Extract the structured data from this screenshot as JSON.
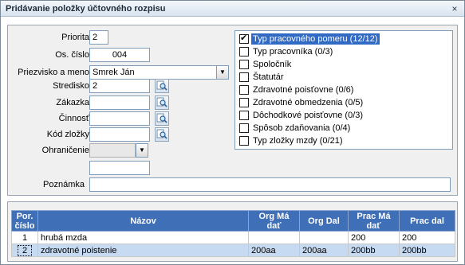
{
  "window": {
    "title": "Pridávanie položky účtovného rozpisu",
    "close_glyph": "×"
  },
  "form": {
    "priorita": {
      "label": "Priorita",
      "value": "2"
    },
    "os_cislo": {
      "label": "Os. číslo",
      "value": "004"
    },
    "priezvisko": {
      "label": "Priezvisko a meno",
      "value": "Smrek Ján"
    },
    "stredisko": {
      "label": "Stredisko",
      "value": "2"
    },
    "zakazka": {
      "label": "Zákazka",
      "value": ""
    },
    "cinnost": {
      "label": "Činnosť",
      "value": ""
    },
    "kod_zlozky": {
      "label": "Kód zložky",
      "value": ""
    },
    "obmedzenie": {
      "label": "Ohraničenie",
      "value": ""
    },
    "extra": {
      "value": ""
    },
    "poznamka": {
      "label": "Poznámka",
      "value": ""
    }
  },
  "icons": {
    "lookup": "search-lookup-icon",
    "dropdown": "chevron-down-icon"
  },
  "checklist": [
    {
      "label": "Typ pracovného pomeru (12/12)",
      "checked": true,
      "selected": true
    },
    {
      "label": "Typ pracovníka (0/3)",
      "checked": false,
      "selected": false
    },
    {
      "label": "Spoločník",
      "checked": false,
      "selected": false
    },
    {
      "label": "Štatutár",
      "checked": false,
      "selected": false
    },
    {
      "label": "Zdravotné poisťovne (0/6)",
      "checked": false,
      "selected": false
    },
    {
      "label": "Zdravotné obmedzenia (0/5)",
      "checked": false,
      "selected": false
    },
    {
      "label": "Dôchodkové poisťovne (0/3)",
      "checked": false,
      "selected": false
    },
    {
      "label": "Spôsob zdaňovania (0/4)",
      "checked": false,
      "selected": false
    },
    {
      "label": "Typ zložky mzdy (0/21)",
      "checked": false,
      "selected": false
    }
  ],
  "grid": {
    "headers": [
      "Por. číslo",
      "Názov",
      "Org Má dať",
      "Org Dal",
      "Prac Má dať",
      "Prac dal"
    ],
    "rows": [
      {
        "cislo": "1",
        "nazov": "hrubá mzda",
        "org_ma_dat": "",
        "org_dal": "",
        "prac_ma_dat": "200",
        "prac_dal": "200",
        "selected": false
      },
      {
        "cislo": "2",
        "nazov": "zdravotné poistenie",
        "org_ma_dat": "200aa",
        "org_dal": "200aa",
        "prac_ma_dat": "200bb",
        "prac_dal": "200bb",
        "selected": true
      }
    ]
  },
  "colors": {
    "header_blue": "#3f6fb6",
    "selection_blue": "#316ac5",
    "selected_row": "#c6daf2"
  }
}
